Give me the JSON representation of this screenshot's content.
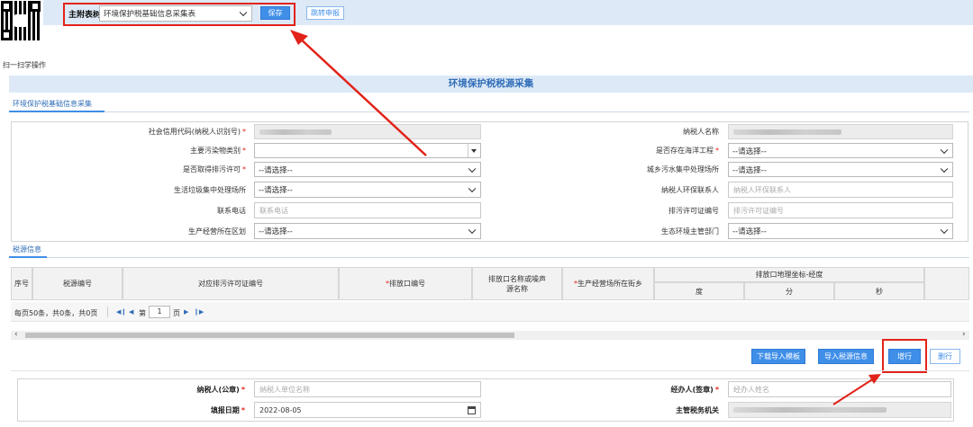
{
  "qr": {
    "label": "扫一扫学操作"
  },
  "topbar": {
    "form_label": "主附表树:",
    "form_value": "环境保护税基础信息采集表",
    "save_label": "保存",
    "jump_label": "跳转申报"
  },
  "title": "环境保护税税源采集",
  "tab_basic": "环境保护税基础信息采集",
  "fields": {
    "credit_code_label": "社会信用代码(纳税人识别号)",
    "taxpayer_name_label": "纳税人名称",
    "pollutant_type_label": "主要污染物类别",
    "marine_label": "是否存在海洋工程",
    "marine_value": "--请选择--",
    "permit_label": "是否取得排污许可",
    "permit_value": "--请选择--",
    "sewage_label": "城乡污水集中处理场所",
    "sewage_value": "--请选择--",
    "garbage_label": "生活垃圾集中处理场所",
    "garbage_value": "--请选择--",
    "env_contact_label": "纳税人环保联系人",
    "env_contact_placeholder": "纳税人环保联系人",
    "phone_label": "联系电话",
    "phone_placeholder": "联系电话",
    "permit_no_label": "排污许可证编号",
    "permit_no_placeholder": "排污许可证编号",
    "district_label": "生产经营所在区划",
    "district_value": "--请选择--",
    "eco_dept_label": "生态环境主管部门",
    "eco_dept_value": "--请选择--"
  },
  "tab_source": "税源信息",
  "table": {
    "headers": {
      "seq": "序号",
      "source_no": "税源编号",
      "permit_no": "对应排污许可证编号",
      "outlet_no": "排放口编号",
      "outlet_name": "排放口名称或噪声源名称",
      "street": "生产经营场所在街乡",
      "coord": "排放口地理坐标-经度",
      "deg": "度",
      "min": "分",
      "sec": "秒"
    },
    "pager": {
      "summary": "每页50条，共0条，共0页",
      "page_prefix": "第",
      "page_value": "1",
      "page_suffix": "页"
    }
  },
  "actions": {
    "download_template": "下载导入模板",
    "import_source": "导入税源信息",
    "add_row": "增行",
    "delete_row": "删行"
  },
  "footer": {
    "taxpayer_seal_label": "纳税人(公章)",
    "taxpayer_seal_placeholder": "纳税人单位名称",
    "agent_label": "经办人(签章)",
    "agent_placeholder": "经办人姓名",
    "fill_date_label": "填报日期",
    "fill_date_value": "2022-08-05",
    "tax_office_label": "主管税务机关"
  },
  "colors": {
    "accent": "#3f8ee8",
    "required": "#e2231a",
    "annotation": "#e2231a"
  }
}
